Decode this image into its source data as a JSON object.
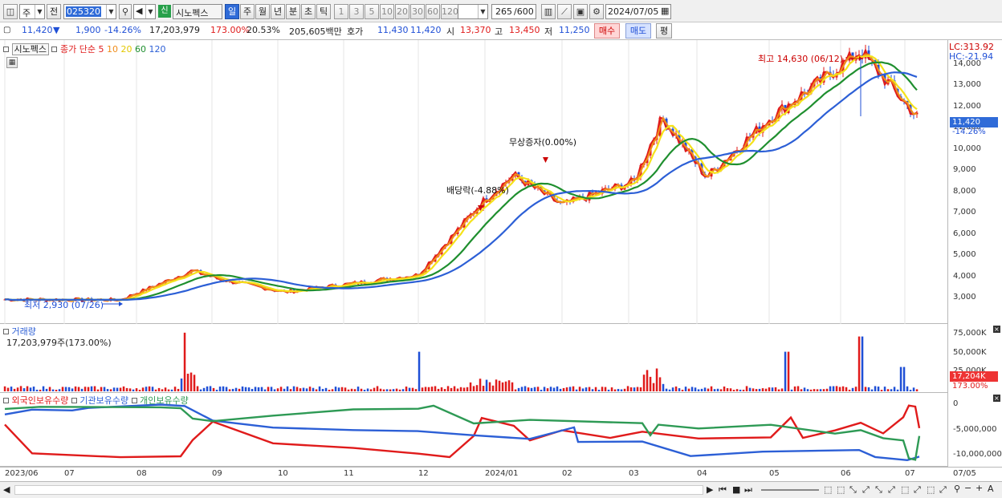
{
  "toolbar": {
    "market_type": "주",
    "prev_label": "전",
    "stock_code": "025320",
    "stock_badge": "신",
    "stock_name": "시노펙스",
    "periods": [
      "일",
      "주",
      "월",
      "년",
      "분",
      "초",
      "틱"
    ],
    "selected_period": "일",
    "intervals": [
      "1",
      "3",
      "5",
      "10",
      "20",
      "30",
      "60",
      "120"
    ],
    "count_value": "265",
    "count_total": "/600",
    "date": "2024/07/05"
  },
  "quote": {
    "price": "11,420",
    "change_arrow": "▼",
    "change": "1,900",
    "change_pct": "-14.26%",
    "volume": "17,203,979",
    "volume_ratio": "173.00%",
    "turnover": "20.53%",
    "amount": "205,605백만",
    "hoga_label": "호가",
    "ask": "11,430",
    "bid": "11,420",
    "open_label": "시",
    "open": "13,370",
    "high_label": "고",
    "high": "13,450",
    "low_label": "저",
    "low": "11,250",
    "buy_button": "매수",
    "sell_button": "매도",
    "eval_button": "평"
  },
  "price_pane": {
    "stock_name": "시노펙스",
    "ma_title": "종가 단순",
    "ma_periods": [
      "5",
      "10",
      "20",
      "60",
      "120"
    ],
    "lc": "LC:313.92",
    "hc": "HC:-21.94",
    "price_flag": "11,420",
    "price_flag_pct": "-14.26%",
    "high_annotation": "최고 14,630 (06/12)",
    "low_annotation": "최저 2,930 (07/26)",
    "dividend_annotation": "배당락(-4.88%)",
    "bonus_annotation": "무상증자(0.00%)",
    "y_ticks": [
      "14,000",
      "13,000",
      "12,000",
      "11,000",
      "10,000",
      "9,000",
      "8,000",
      "7,000",
      "6,000",
      "5,000",
      "4,000",
      "3,000"
    ]
  },
  "volume_pane": {
    "title": "거래량",
    "value": "17,203,979주(173.00%)",
    "y_ticks": [
      "75,000K",
      "50,000K",
      "25,000K"
    ],
    "flag": "17,204K",
    "flag_pct": "173.00%"
  },
  "holding_pane": {
    "series": [
      "외국인보유수량",
      "기관보유수량",
      "개인보유수량"
    ],
    "y_ticks": [
      "0",
      "-5,000,000",
      "-10,000,000"
    ]
  },
  "x_axis": [
    "2023/06",
    "07",
    "08",
    "09",
    "10",
    "11",
    "12",
    "2024/01",
    "02",
    "03",
    "04",
    "05",
    "06",
    "07",
    "07/05"
  ],
  "colors": {
    "up": "#e01b1b",
    "down": "#1f4fd6",
    "ma5": "#e01b1b",
    "ma10": "#f08c1a",
    "ma20": "#f5e21a",
    "ma60": "#1f8f2f",
    "ma120": "#2c5fd6",
    "foreign": "#e01b1b",
    "institution": "#2c5fd6",
    "individual": "#2e9a55"
  },
  "chart_data": {
    "type": "candlestick",
    "y_range": [
      2500,
      14630
    ],
    "close_series_key_points": [
      {
        "x": "2023/06",
        "close": 2950
      },
      {
        "x": "2023/07/26",
        "close": 2930
      },
      {
        "x": "2023/08 late",
        "close": 4300
      },
      {
        "x": "2023/09",
        "close": 3900
      },
      {
        "x": "2023/10",
        "close": 3300
      },
      {
        "x": "2023/11",
        "close": 3700
      },
      {
        "x": "2023/12",
        "close": 4100
      },
      {
        "x": "2023/12 late",
        "close": 7500
      },
      {
        "x": "2024/01",
        "close": 8800
      },
      {
        "x": "2024/02",
        "close": 7400
      },
      {
        "x": "2024/03",
        "close": 8500
      },
      {
        "x": "2024/03 mid",
        "close": 11500
      },
      {
        "x": "2024/04",
        "close": 8700
      },
      {
        "x": "2024/05",
        "close": 11500
      },
      {
        "x": "2024/06/12",
        "close": 14630
      },
      {
        "x": "2024/07/05",
        "close": 11420
      }
    ]
  }
}
